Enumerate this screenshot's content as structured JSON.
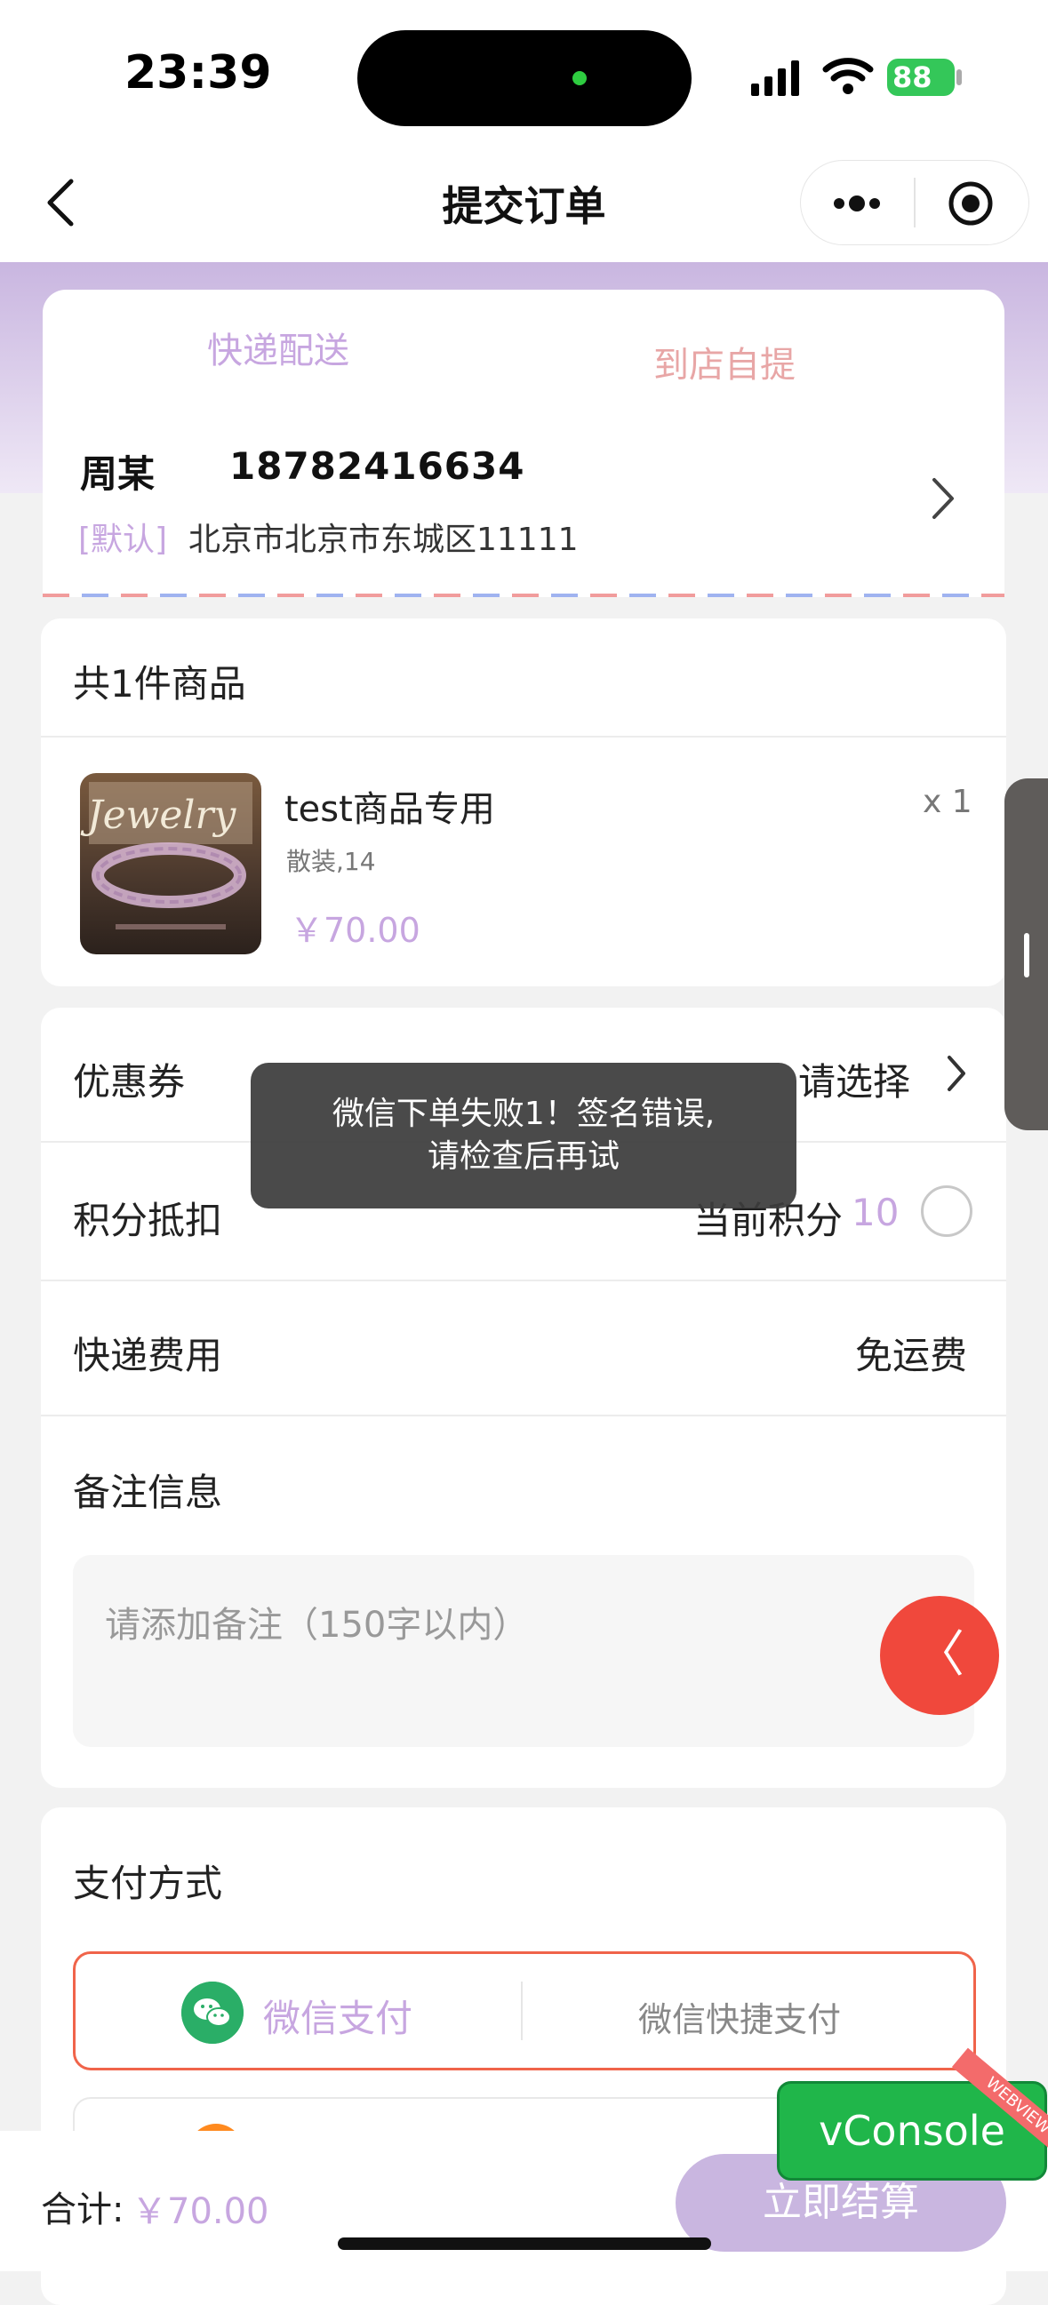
{
  "status_bar": {
    "time": "23:39",
    "battery": "88"
  },
  "nav": {
    "title": "提交订单"
  },
  "delivery_tabs": {
    "express": "快递配送",
    "pickup": "到店自提"
  },
  "address": {
    "name": "周某",
    "phone": "18782416634",
    "default_tag": "[默认]",
    "text": "北京市北京市东城区11111"
  },
  "products": {
    "header": "共1件商品",
    "items": [
      {
        "name": "test商品专用",
        "spec": "散装,14",
        "price": "￥70.00",
        "qty": "x 1",
        "image_text": "Jewelry"
      }
    ]
  },
  "options": {
    "coupon_label": "优惠券",
    "coupon_value": "请选择",
    "points_label": "积分抵扣",
    "points_current_label": "当前积分",
    "points_value": "10",
    "shipping_label": "快递费用",
    "shipping_value": "免运费",
    "note_label": "备注信息",
    "note_placeholder": "请添加备注（150字以内）"
  },
  "toast": {
    "line1": "微信下单失败1！签名错误,",
    "line2": "请检查后再试"
  },
  "payment": {
    "header": "支付方式",
    "wechat": "微信支付",
    "wechat_quick": "微信快捷支付"
  },
  "footer": {
    "total_label": "合计:",
    "total_value": "￥70.00",
    "checkout": "立即结算"
  },
  "floating": {
    "side_button": "〈",
    "vconsole": "vConsole",
    "vconsole_ribbon": "WEBVIEW"
  },
  "colors": {
    "accent": "#c7a6e0",
    "pay_border": "#f0644a",
    "toast_bg": "#3c3c3c",
    "vconsole": "#20b64a"
  }
}
